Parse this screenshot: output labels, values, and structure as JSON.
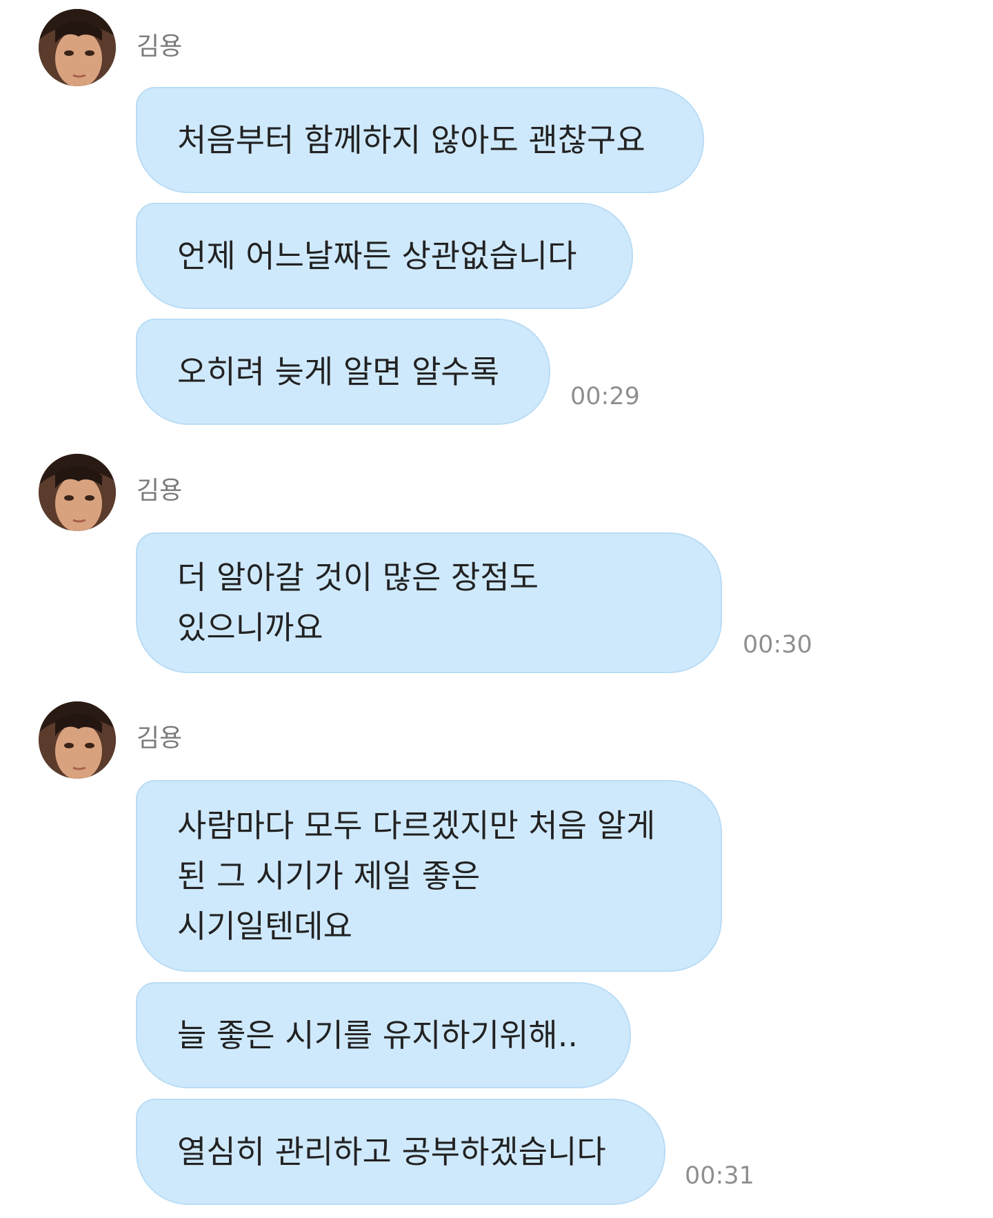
{
  "groups": [
    {
      "sender": "김용",
      "messages": [
        "처음부터 함께하지 않아도 괜찮구요",
        "언제 어느날짜든 상관없습니다",
        "오히려 늦게 알면 알수록"
      ],
      "time": "00:29"
    },
    {
      "sender": "김용",
      "messages": [
        "더 알아갈 것이 많은 장점도\n있으니까요"
      ],
      "time": "00:30"
    },
    {
      "sender": "김용",
      "messages": [
        "사람마다 모두 다르겠지만 처음 알게\n된 그 시기가 제일 좋은\n시기일텐데요",
        "늘 좋은 시기를 유지하기위해..",
        "열심히 관리하고 공부하겠습니다"
      ],
      "time": "00:31"
    }
  ],
  "colors": {
    "bubble": "#cfe9fc",
    "bubble_border": "#b9dcf5",
    "text": "#222222",
    "meta_text": "#8f8f8f"
  },
  "icons": {
    "avatar": "profile-photo-avatar"
  }
}
